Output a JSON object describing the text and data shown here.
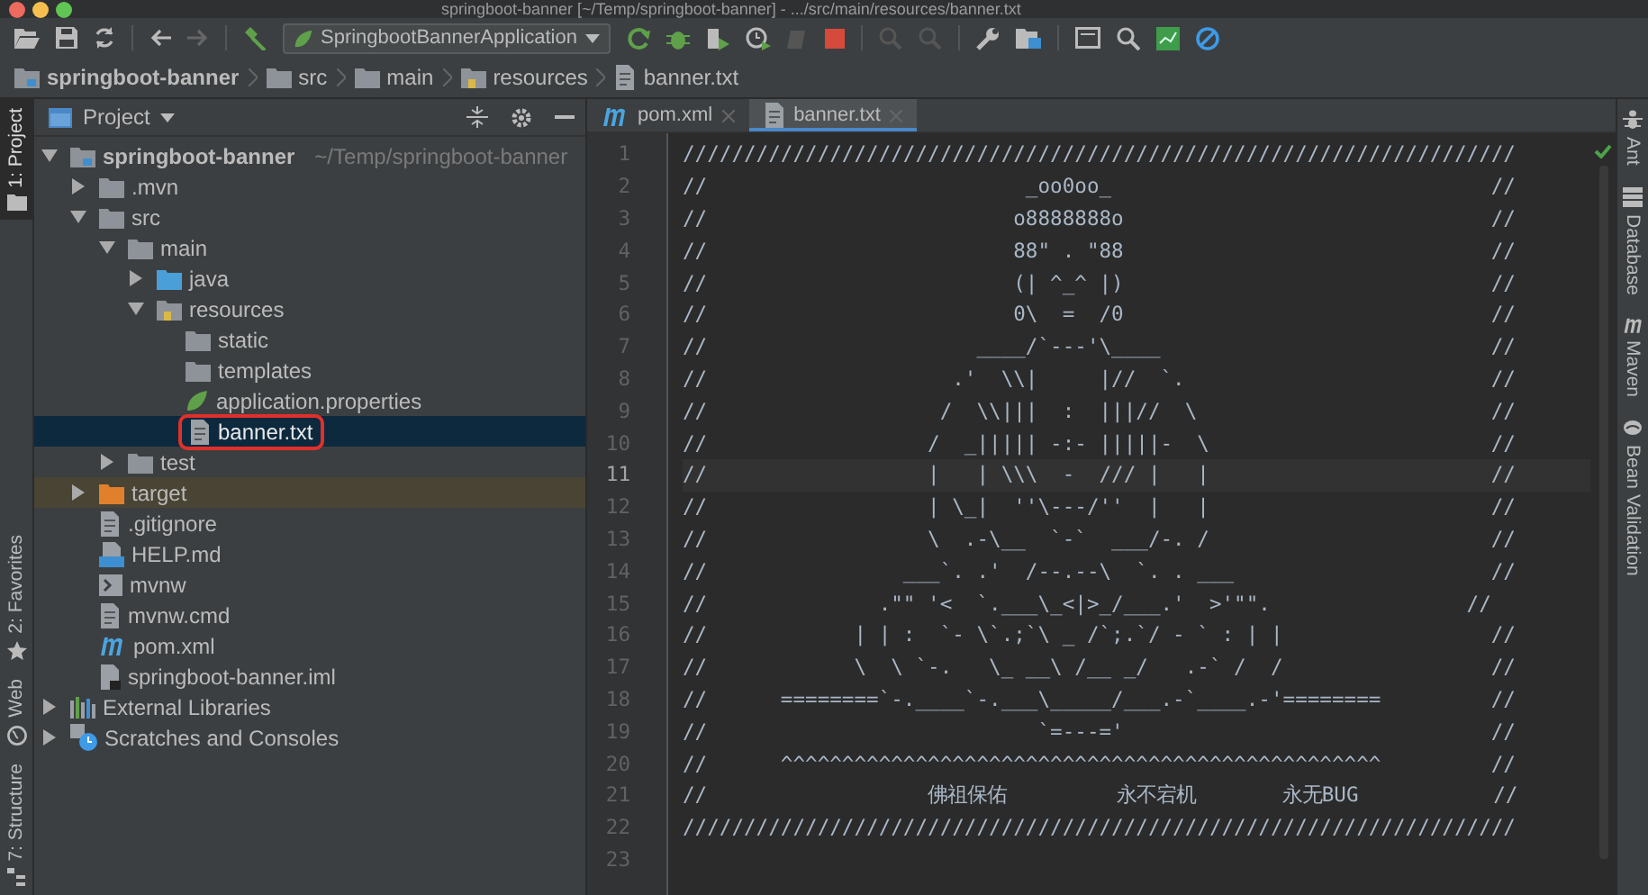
{
  "window": {
    "title": "springboot-banner [~/Temp/springboot-banner] - .../src/main/resources/banner.txt"
  },
  "toolbar": {
    "run_configuration": "SpringbootBannerApplication"
  },
  "breadcrumbs": [
    {
      "label": "springboot-banner",
      "kind": "module"
    },
    {
      "label": "src",
      "kind": "folder"
    },
    {
      "label": "main",
      "kind": "folder"
    },
    {
      "label": "resources",
      "kind": "resource-folder"
    },
    {
      "label": "banner.txt",
      "kind": "text-file"
    }
  ],
  "left_tool_strip": {
    "top": [
      {
        "label": "1: Project",
        "kind": "folder",
        "selected": true
      }
    ],
    "bottom": [
      {
        "label": "2: Favorites",
        "kind": "star",
        "selected": false
      },
      {
        "label": "Web",
        "kind": "globe",
        "selected": false
      },
      {
        "label": "7: Structure",
        "kind": "structure",
        "selected": false
      }
    ]
  },
  "project_panel": {
    "title": "Project",
    "tree": [
      {
        "label": "springboot-banner",
        "hint": "~/Temp/springboot-banner",
        "kind": "module",
        "expanded": true,
        "selected": false,
        "marked": false,
        "children": [
          {
            "label": ".mvn",
            "kind": "folder",
            "expanded": false,
            "selected": false,
            "marked": false
          },
          {
            "label": "src",
            "kind": "folder",
            "expanded": true,
            "selected": false,
            "marked": false,
            "children": [
              {
                "label": "main",
                "kind": "folder",
                "expanded": true,
                "selected": false,
                "marked": false,
                "children": [
                  {
                    "label": "java",
                    "kind": "source-folder",
                    "expanded": false,
                    "selected": false,
                    "marked": false
                  },
                  {
                    "label": "resources",
                    "kind": "resource-folder",
                    "expanded": true,
                    "selected": false,
                    "marked": false,
                    "children": [
                      {
                        "label": "static",
                        "kind": "folder",
                        "selected": false,
                        "marked": false
                      },
                      {
                        "label": "templates",
                        "kind": "folder",
                        "selected": false,
                        "marked": false
                      },
                      {
                        "label": "application.properties",
                        "kind": "properties",
                        "selected": false,
                        "marked": false
                      },
                      {
                        "label": "banner.txt",
                        "kind": "text-file",
                        "selected": true,
                        "marked": true
                      }
                    ]
                  }
                ]
              },
              {
                "label": "test",
                "kind": "folder",
                "expanded": false,
                "selected": false,
                "marked": false
              }
            ]
          },
          {
            "label": "target",
            "kind": "excluded-folder",
            "expanded": false,
            "selected": false,
            "marked": false
          },
          {
            "label": ".gitignore",
            "kind": "text-file",
            "selected": false,
            "marked": false
          },
          {
            "label": "HELP.md",
            "kind": "markdown",
            "selected": false,
            "marked": false
          },
          {
            "label": "mvnw",
            "kind": "script",
            "selected": false,
            "marked": false
          },
          {
            "label": "mvnw.cmd",
            "kind": "text-file",
            "selected": false,
            "marked": false
          },
          {
            "label": "pom.xml",
            "kind": "maven",
            "selected": false,
            "marked": false
          },
          {
            "label": "springboot-banner.iml",
            "kind": "iml",
            "selected": false,
            "marked": false
          }
        ]
      },
      {
        "label": "External Libraries",
        "kind": "libraries",
        "expanded": false,
        "selected": false,
        "marked": false
      },
      {
        "label": "Scratches and Consoles",
        "kind": "scratches",
        "expanded": false,
        "selected": false,
        "marked": false
      }
    ]
  },
  "editor": {
    "tabs": [
      {
        "label": "pom.xml",
        "kind": "maven",
        "selected": false
      },
      {
        "label": "banner.txt",
        "kind": "text-file",
        "selected": true
      }
    ],
    "lines": [
      {
        "number": "1",
        "current": false,
        "text": "////////////////////////////////////////////////////////////////////"
      },
      {
        "number": "2",
        "current": false,
        "text": "//                          _oo0oo_                               //"
      },
      {
        "number": "3",
        "current": false,
        "text": "//                         o8888888o                              //"
      },
      {
        "number": "4",
        "current": false,
        "text": "//                         88\" . \"88                              //"
      },
      {
        "number": "5",
        "current": false,
        "text": "//                         (| ^_^ |)                              //"
      },
      {
        "number": "6",
        "current": false,
        "text": "//                         0\\  =  /0                              //"
      },
      {
        "number": "7",
        "current": false,
        "text": "//                      ____/`---'\\____                           //"
      },
      {
        "number": "8",
        "current": false,
        "text": "//                    .'  \\\\|     |//  `.                         //"
      },
      {
        "number": "9",
        "current": false,
        "text": "//                   /  \\\\|||  :  |||//  \\                        //"
      },
      {
        "number": "10",
        "current": false,
        "text": "//                  /  _||||| -:- |||||-  \\                       //"
      },
      {
        "number": "11",
        "current": true,
        "text": "//                  |   | \\\\\\  -  /// |   |                       //"
      },
      {
        "number": "12",
        "current": false,
        "text": "//                  | \\_|  ''\\---/''  |   |                       //"
      },
      {
        "number": "13",
        "current": false,
        "text": "//                  \\  .-\\__  `-`  ___/-. /                       //"
      },
      {
        "number": "14",
        "current": false,
        "text": "//                ___`. .'  /--.--\\  `. . ___                     //"
      },
      {
        "number": "15",
        "current": false,
        "text": "//              .\"\" '<  `.___\\_<|>_/___.'  >'\"\".                //"
      },
      {
        "number": "16",
        "current": false,
        "text": "//            | | :  `- \\`.;`\\ _ /`;.`/ - ` : | |                 //"
      },
      {
        "number": "17",
        "current": false,
        "text": "//            \\  \\ `-.   \\_ __\\ /__ _/   .-` /  /                 //"
      },
      {
        "number": "18",
        "current": false,
        "text": "//      ========`-.____`-.___\\_____/___.-`____.-'========         //"
      },
      {
        "number": "19",
        "current": false,
        "text": "//                           `=---='                              //"
      },
      {
        "number": "20",
        "current": false,
        "text": "//      ^^^^^^^^^^^^^^^^^^^^^^^^^^^^^^^^^^^^^^^^^^^^^^^^^         //"
      },
      {
        "number": "21",
        "current": false,
        "text": "//                  佛祖保佑         永不宕机       永无BUG           //"
      },
      {
        "number": "22",
        "current": false,
        "text": "////////////////////////////////////////////////////////////////////"
      },
      {
        "number": "23",
        "current": false
      }
    ]
  },
  "right_tool_strip": [
    {
      "label": "Ant",
      "kind": "ant"
    },
    {
      "label": "Database",
      "kind": "database"
    },
    {
      "label": "Maven",
      "kind": "maven"
    },
    {
      "label": "Bean Validation",
      "kind": "bean"
    }
  ]
}
